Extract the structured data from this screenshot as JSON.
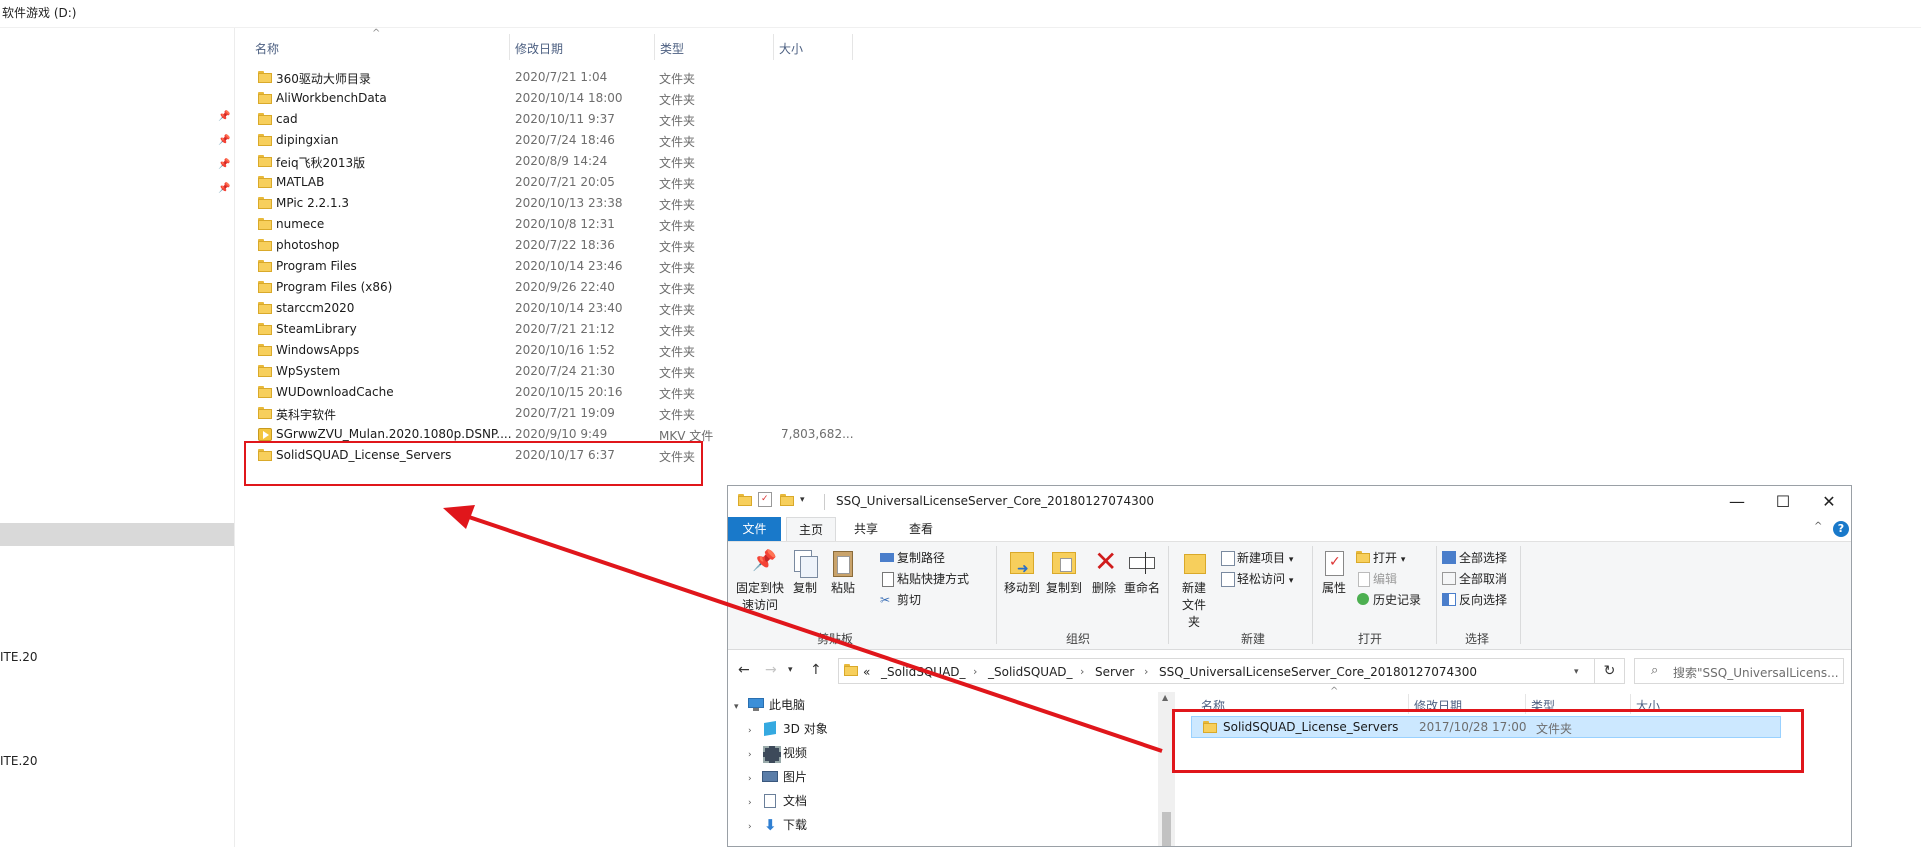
{
  "background": {
    "title": "软件游戏 (D:)",
    "nav_truncated": [
      "ITE.20",
      "ITE.20"
    ],
    "columns": {
      "name": "名称",
      "date": "修改日期",
      "type": "类型",
      "size": "大小"
    },
    "rows": [
      {
        "name": "360驱动大师目录",
        "date": "2020/7/21 1:04",
        "type": "文件夹",
        "size": ""
      },
      {
        "name": "AliWorkbenchData",
        "date": "2020/10/14 18:00",
        "type": "文件夹",
        "size": ""
      },
      {
        "name": "cad",
        "date": "2020/10/11 9:37",
        "type": "文件夹",
        "size": ""
      },
      {
        "name": "dipingxian",
        "date": "2020/7/24 18:46",
        "type": "文件夹",
        "size": ""
      },
      {
        "name": "feiq飞秋2013版",
        "date": "2020/8/9 14:24",
        "type": "文件夹",
        "size": ""
      },
      {
        "name": "MATLAB",
        "date": "2020/7/21 20:05",
        "type": "文件夹",
        "size": ""
      },
      {
        "name": "MPic 2.2.1.3",
        "date": "2020/10/13 23:38",
        "type": "文件夹",
        "size": ""
      },
      {
        "name": "numece",
        "date": "2020/10/8 12:31",
        "type": "文件夹",
        "size": ""
      },
      {
        "name": "photoshop",
        "date": "2020/7/22 18:36",
        "type": "文件夹",
        "size": ""
      },
      {
        "name": "Program Files",
        "date": "2020/10/14 23:46",
        "type": "文件夹",
        "size": ""
      },
      {
        "name": "Program Files (x86)",
        "date": "2020/9/26 22:40",
        "type": "文件夹",
        "size": ""
      },
      {
        "name": "starccm2020",
        "date": "2020/10/14 23:40",
        "type": "文件夹",
        "size": ""
      },
      {
        "name": "SteamLibrary",
        "date": "2020/7/21 21:12",
        "type": "文件夹",
        "size": ""
      },
      {
        "name": "WindowsApps",
        "date": "2020/10/16 1:52",
        "type": "文件夹",
        "size": ""
      },
      {
        "name": "WpSystem",
        "date": "2020/7/24 21:30",
        "type": "文件夹",
        "size": ""
      },
      {
        "name": "WUDownloadCache",
        "date": "2020/10/15 20:16",
        "type": "文件夹",
        "size": ""
      },
      {
        "name": "英科宇软件",
        "date": "2020/7/21 19:09",
        "type": "文件夹",
        "size": ""
      },
      {
        "name": "SGrwwZVU_Mulan.2020.1080p.DSNP....",
        "date": "2020/9/10 9:49",
        "type": "MKV 文件",
        "size": "7,803,682..."
      },
      {
        "name": "SolidSQUAD_License_Servers",
        "date": "2020/10/17 6:37",
        "type": "文件夹",
        "size": ""
      }
    ]
  },
  "window": {
    "title": "SSQ_UniversalLicenseServer_Core_20180127074300",
    "controls": {
      "minimize": "—",
      "maximize": "☐",
      "close": "✕"
    },
    "tabs": [
      "文件",
      "主页",
      "共享",
      "查看"
    ],
    "ribbon": {
      "clipboard": {
        "label": "剪贴板",
        "pin": "固定到快速访问",
        "copy": "复制",
        "paste": "粘贴",
        "copy_path": "复制路径",
        "paste_shortcut": "粘贴快捷方式",
        "cut": "剪切"
      },
      "organize": {
        "label": "组织",
        "move_to": "移动到",
        "copy_to": "复制到",
        "delete": "删除",
        "rename": "重命名"
      },
      "new": {
        "label": "新建",
        "new_folder": "新建文件夹",
        "new_item": "新建项目",
        "easy_access": "轻松访问"
      },
      "open": {
        "label": "打开",
        "properties": "属性",
        "open": "打开",
        "edit": "编辑",
        "history": "历史记录"
      },
      "select": {
        "label": "选择",
        "select_all": "全部选择",
        "select_none": "全部取消",
        "invert": "反向选择"
      }
    },
    "address": {
      "overflow": "«",
      "crumbs": [
        "_SolidSQUAD_",
        "_SolidSQUAD_",
        "Server",
        "SSQ_UniversalLicenseServer_Core_20180127074300"
      ],
      "search_placeholder": "搜索\"SSQ_UniversalLicens..."
    },
    "tree": [
      {
        "label": "此电脑",
        "icon": "computer-icon"
      },
      {
        "label": "3D 对象",
        "icon": "3d-objects-icon"
      },
      {
        "label": "视频",
        "icon": "video-icon"
      },
      {
        "label": "图片",
        "icon": "pictures-icon"
      },
      {
        "label": "文档",
        "icon": "documents-icon"
      },
      {
        "label": "下载",
        "icon": "download-icon"
      }
    ],
    "columns": {
      "name": "名称",
      "date": "修改日期",
      "type": "类型",
      "size": "大小"
    },
    "row": {
      "name": "SolidSQUAD_License_Servers",
      "date": "2017/10/28 17:00",
      "type": "文件夹"
    }
  },
  "colors": {
    "annotation": "#e0161b",
    "accent": "#1979ca",
    "selection": "#cce8ff"
  }
}
